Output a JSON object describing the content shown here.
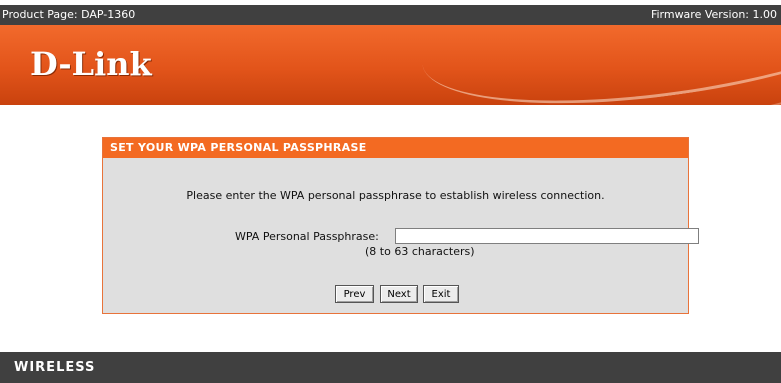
{
  "topbar": {
    "product": "Product Page: DAP-1360",
    "firmware": "Firmware Version: 1.00"
  },
  "banner": {
    "logo": "D-Link"
  },
  "panel": {
    "title": "SET YOUR WPA PERSONAL PASSPHRASE",
    "instruction": "Please enter the WPA personal passphrase to establish wireless connection.",
    "field_label": "WPA Personal Passphrase:",
    "field_value": "",
    "hint": "(8 to 63 characters)"
  },
  "buttons": {
    "prev": "Prev",
    "next": "Next",
    "exit": "Exit"
  },
  "footer": {
    "label": "WIRELESS"
  }
}
